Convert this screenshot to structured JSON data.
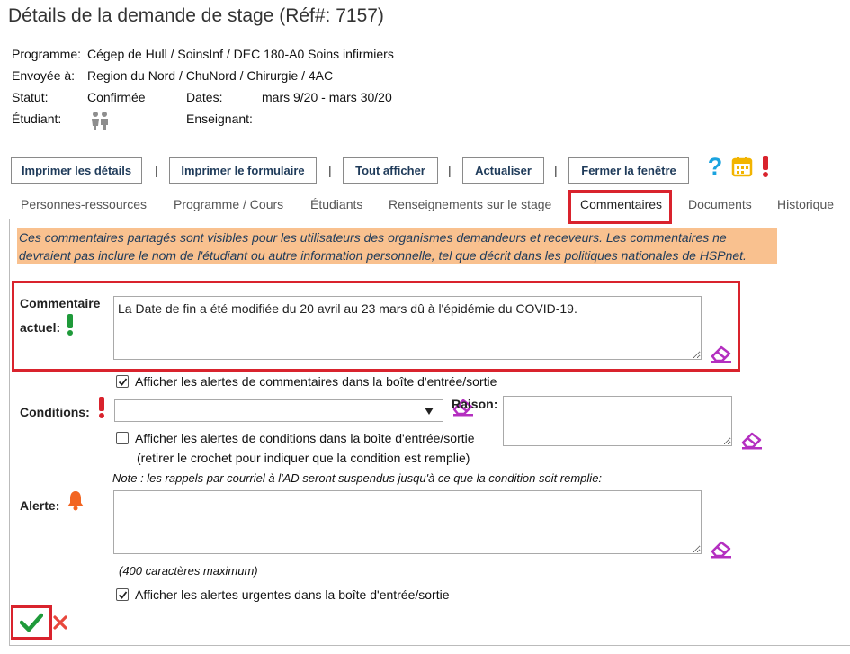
{
  "page": {
    "title": "Détails de la demande de stage (Réf#: 7157)"
  },
  "details": {
    "programme_label": "Programme:",
    "programme_value": "Cégep de Hull / SoinsInf / DEC 180-A0 Soins infirmiers",
    "envoyee_label": "Envoyée à:",
    "envoyee_value": "Region du Nord / ChuNord / Chirurgie / 4AC",
    "statut_label": "Statut:",
    "statut_value": "Confirmée",
    "dates_label": "Dates:",
    "dates_value": "mars 9/20 - mars 30/20",
    "etudiant_label": "Étudiant:",
    "enseignant_label": "Enseignant:"
  },
  "toolbar": {
    "print_details": "Imprimer les détails",
    "print_form": "Imprimer le formulaire",
    "show_all": "Tout afficher",
    "refresh": "Actualiser",
    "close_window": "Fermer la fenêtre",
    "separator": "|"
  },
  "tabs": [
    {
      "label": "Personnes-ressources"
    },
    {
      "label": "Programme / Cours"
    },
    {
      "label": "Étudiants"
    },
    {
      "label": "Renseignements sur le stage"
    },
    {
      "label": "Commentaires"
    },
    {
      "label": "Documents"
    },
    {
      "label": "Historique"
    }
  ],
  "notice": {
    "line1": "Ces commentaires partagés sont visibles pour les utilisateurs des organismes demandeurs et receveurs. Les commentaires ne",
    "line2": "devraient pas inclure le nom de l'étudiant ou autre information personnelle, tel que décrit dans les politiques nationales de HSPnet."
  },
  "comment": {
    "label_line1": "Commentaire",
    "label_line2": "actuel",
    "colon": ":",
    "value": "La Date de fin a été modifiée du 20 avril au 23 mars dû à l'épidémie du COVID-19.",
    "alert_checkbox_label": "Afficher les alertes de commentaires dans la boîte d'entrée/sortie",
    "alert_checked": true
  },
  "conditions": {
    "label": "Conditions",
    "colon": ":",
    "select_value": "",
    "raison_label": "Raison",
    "raison_colon": ":",
    "raison_value": "",
    "alert_checkbox_label": "Afficher les alertes de conditions dans la boîte d'entrée/sortie",
    "alert_checked": false,
    "hint": "(retirer le crochet pour indiquer que la condition est remplie)",
    "note": "Note : les rappels par courriel à l'AD seront suspendus jusqu'à ce que la condition soit remplie:"
  },
  "alerte": {
    "label": "Alerte",
    "colon": ":",
    "value": "",
    "max_chars": "(400 caractères maximum)",
    "urgent_checkbox_label": "Afficher les alertes urgentes dans la boîte d'entrée/sortie",
    "urgent_checked": true
  },
  "colors": {
    "accent_red": "#d9232d",
    "notice_bg": "#f9c18f",
    "help_blue": "#1aa3df",
    "calendar_yellow": "#f2b400",
    "eraser_purple": "#b42fc0",
    "check_green": "#1f9a3a"
  },
  "icons": [
    "help-icon",
    "calendar-icon",
    "exclamation-icon",
    "students-icon",
    "eraser-icon",
    "bell-icon",
    "checkmark-icon",
    "cancel-icon"
  ]
}
